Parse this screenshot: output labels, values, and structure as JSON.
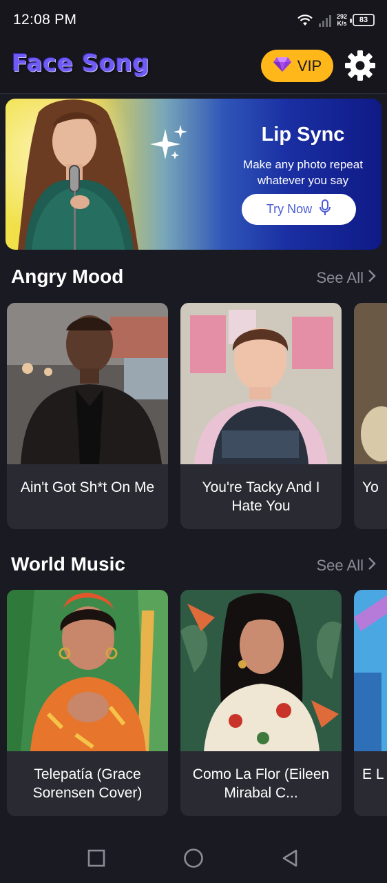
{
  "status_bar": {
    "time": "12:08 PM",
    "net_speed_value": "292",
    "net_speed_unit": "K/s",
    "battery": "83",
    "icons": [
      "wifi-icon",
      "signal-icon",
      "battery-icon"
    ]
  },
  "header": {
    "logo": "Face Song",
    "vip_label": "VIP",
    "vip_icon": "diamond-icon",
    "settings_icon": "gear-icon"
  },
  "banner": {
    "title": "Lip Sync",
    "subtitle": "Make any photo repeat whatever you say",
    "button_label": "Try Now",
    "button_icon": "microphone-icon"
  },
  "sections": [
    {
      "title": "Angry Mood",
      "see_all": "See All",
      "cards": [
        {
          "title": "Ain't Got Sh*t On Me"
        },
        {
          "title": "You're Tacky And I Hate You"
        },
        {
          "title": "Yo"
        }
      ]
    },
    {
      "title": "World Music",
      "see_all": "See All",
      "cards": [
        {
          "title": "Telepatía (Grace Sorensen Cover)"
        },
        {
          "title": "Como La Flor (Eileen Mirabal C..."
        },
        {
          "title": "E L"
        }
      ]
    }
  ],
  "nav": {
    "icons": [
      "recent-apps-icon",
      "home-icon",
      "back-icon"
    ]
  },
  "colors": {
    "background": "#1a1a22",
    "card": "#2a2a33",
    "vip": "#ffb71a",
    "logo": "#6f5cf5",
    "muted_text": "#8c8c96"
  }
}
